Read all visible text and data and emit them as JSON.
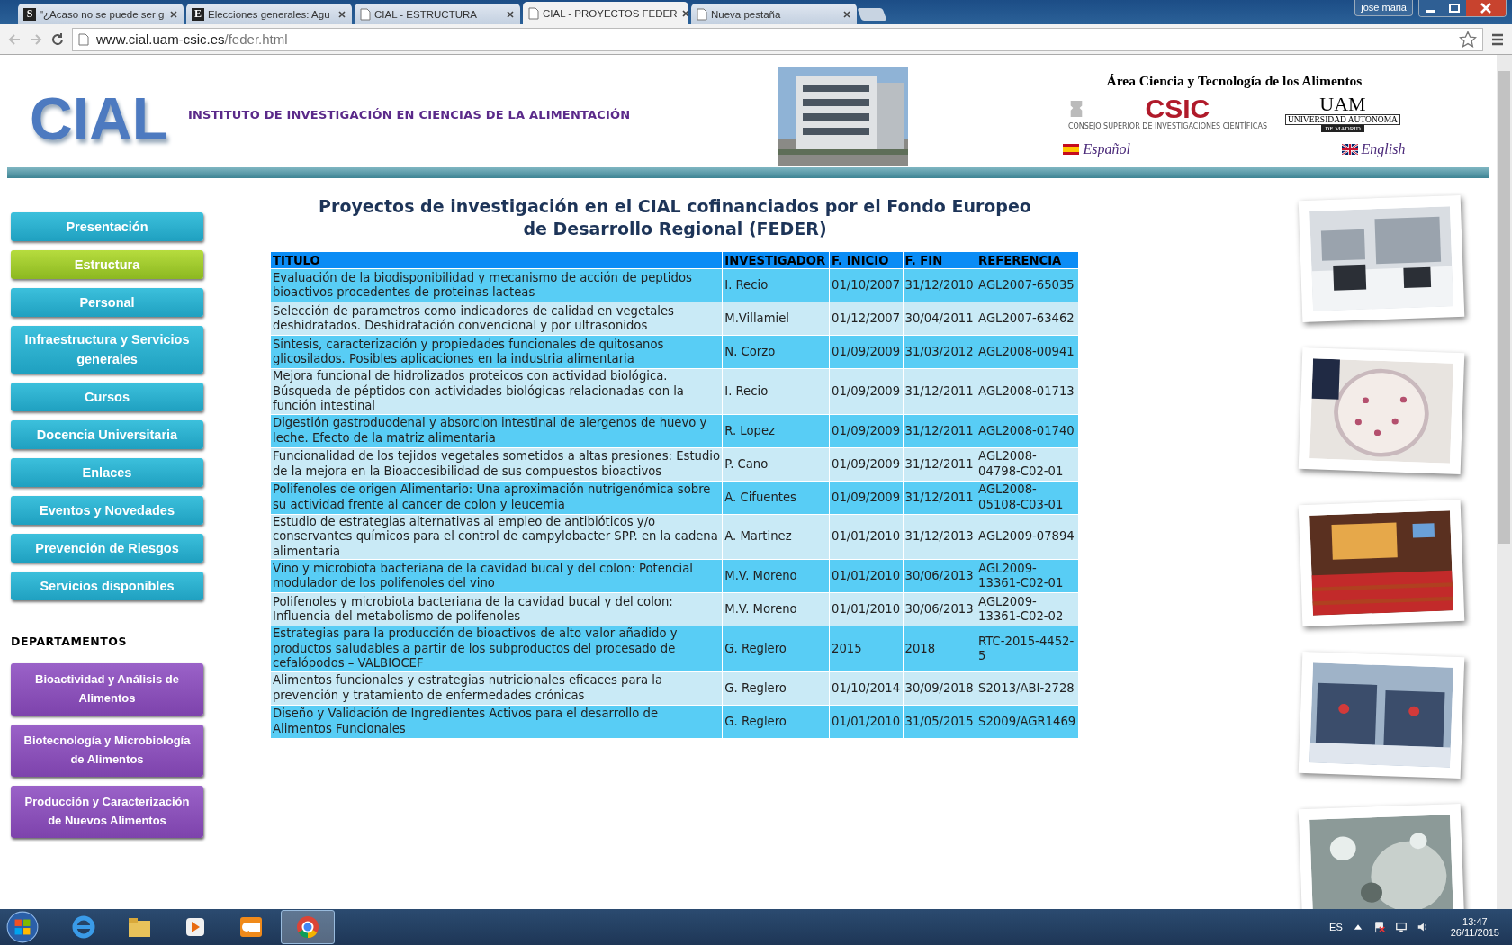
{
  "browser": {
    "tabs": [
      {
        "title": "\"¿Acaso no se puede ser g",
        "icon": "S",
        "selected": false
      },
      {
        "title": "Elecciones generales: Agu",
        "icon": "E",
        "selected": false
      },
      {
        "title": "CIAL - ESTRUCTURA",
        "selected": false
      },
      {
        "title": "CIAL - PROYECTOS FEDER",
        "selected": true
      },
      {
        "title": "Nueva pestaña",
        "selected": false
      }
    ],
    "user": "jose maria",
    "url_host": "www.cial.uam-csic.es",
    "url_path": "/feder.html"
  },
  "header": {
    "logo": "CIAL",
    "institute": "INSTITUTO DE INVESTIGACIÓN EN CIENCIAS DE LA ALIMENTACIÓN",
    "area": "Área Ciencia y Tecnología de los Alimentos",
    "csic": "CSIC",
    "csic_sub": "CONSEJO SUPERIOR DE INVESTIGACIONES CIENTÍFICAS",
    "uam": "UAM",
    "uam_line1": "UNIVERSIDAD AUTONOMA",
    "uam_line2": "DE MADRID",
    "languages": [
      {
        "label": "Español",
        "kind": "spanish"
      },
      {
        "label": "English",
        "kind": "british"
      }
    ]
  },
  "nav": [
    {
      "label": "Presentación",
      "selected": false
    },
    {
      "label": "Estructura",
      "selected": true
    },
    {
      "label": "Personal",
      "selected": false
    },
    {
      "label": "Infraestructura y Servicios generales",
      "selected": false
    },
    {
      "label": "Cursos",
      "selected": false
    },
    {
      "label": "Docencia Universitaria",
      "selected": false
    },
    {
      "label": "Enlaces",
      "selected": false
    },
    {
      "label": "Eventos y Novedades",
      "selected": false
    },
    {
      "label": "Prevención de Riesgos",
      "selected": false
    },
    {
      "label": "Servicios disponibles",
      "selected": false
    }
  ],
  "departments_heading": "DEPARTAMENTOS",
  "departments": [
    "Bioactividad y Análisis de Alimentos",
    "Biotecnología y Microbiología de Alimentos",
    "Producción y Caracterización de Nuevos Alimentos"
  ],
  "title": "Proyectos de investigación en el **CIAL** cofinanciados por el Fondo Europeo de Desarrollo Regional (FEDER)",
  "table": {
    "columns": [
      "TITULO",
      "INVESTIGADOR",
      "F. INICIO",
      "F. FIN",
      "REFERENCIA"
    ],
    "rows": [
      [
        "Evaluación de la biodisponibilidad y mecanismo de acción de peptidos bioactivos procedentes de proteinas lacteas",
        "I. Recio",
        "01/10/2007",
        "31/12/2010",
        "AGL2007-65035"
      ],
      [
        "Selección de parametros como indicadores de calidad en vegetales deshidratados. Deshidratación convencional y por ultrasonidos",
        "M.Villamiel",
        "01/12/2007",
        "30/04/2011",
        "AGL2007-63462"
      ],
      [
        "Síntesis, caracterización y propiedades funcionales de quitosanos glicosilados. Posibles aplicaciones en la industria alimentaria",
        "N. Corzo",
        "01/09/2009",
        "31/03/2012",
        "AGL2008-00941"
      ],
      [
        "Mejora funcional de hidrolizados proteicos con actividad biológica. Búsqueda de péptidos con actividades biológicas relacionadas con la función intestinal",
        "I. Recio",
        "01/09/2009",
        "31/12/2011",
        "AGL2008-01713"
      ],
      [
        "Digestión gastroduodenal y absorcion intestinal de alergenos de huevo y leche. Efecto de la matriz alimentaria",
        "R. Lopez",
        "01/09/2009",
        "31/12/2011",
        "AGL2008-01740"
      ],
      [
        "Funcionalidad de los tejidos vegetales sometidos a altas presiones: Estudio de la mejora en la Bioaccesibilidad de sus compuestos bioactivos",
        "P. Cano",
        "01/09/2009",
        "31/12/2011",
        "AGL2008-04798-C02-01"
      ],
      [
        "Polifenoles de origen Alimentario: Una aproximación nutrigenómica sobre su actividad frente al cancer de colon y leucemia",
        "A. Cifuentes",
        "01/09/2009",
        "31/12/2011",
        "AGL2008-05108-C03-01"
      ],
      [
        "Estudio de estrategias alternativas al empleo de antibióticos y/o conservantes químicos para el control de campylobacter SPP. en la cadena alimentaria",
        "A. Martinez",
        "01/01/2010",
        "31/12/2013",
        "AGL2009-07894"
      ],
      [
        "Vino y microbiota bacteriana de la cavidad bucal y del colon: Potencial modulador de los polifenoles del vino",
        "M.V. Moreno",
        "01/01/2010",
        "30/06/2013",
        "AGL2009-13361-C02-01"
      ],
      [
        "Polifenoles y microbiota bacteriana de la cavidad bucal y del colon: Influencia del metabolismo de polifenoles",
        "M.V. Moreno",
        "01/01/2010",
        "30/06/2013",
        "AGL2009-13361-C02-02"
      ],
      [
        "Estrategias para la producción de bioactivos de alto valor añadido y productos saludables a partir de los subproductos del procesado de cefalópodos – VALBIOCEF",
        "G. Reglero",
        "2015",
        "2018",
        "RTC-2015-4452-5"
      ],
      [
        "Alimentos funcionales y estrategias nutricionales eficaces para la prevención y tratamiento de enfermedades crónicas",
        "G. Reglero",
        "01/10/2014",
        "30/09/2018",
        "S2013/ABI-2728"
      ],
      [
        "Diseño y Validación de Ingredientes Activos para el desarrollo de Alimentos Funcionales",
        "G. Reglero",
        "01/01/2010",
        "31/05/2015",
        "S2009/AGR1469"
      ]
    ]
  },
  "taskbar": {
    "apps": [
      {
        "kind": "ie",
        "selected": false
      },
      {
        "kind": "folder",
        "selected": false
      },
      {
        "kind": "media",
        "selected": false
      },
      {
        "kind": "outlook",
        "selected": false
      },
      {
        "kind": "chrome",
        "selected": true
      }
    ],
    "language": "ES",
    "time": "13:47",
    "date": "26/11/2015"
  }
}
